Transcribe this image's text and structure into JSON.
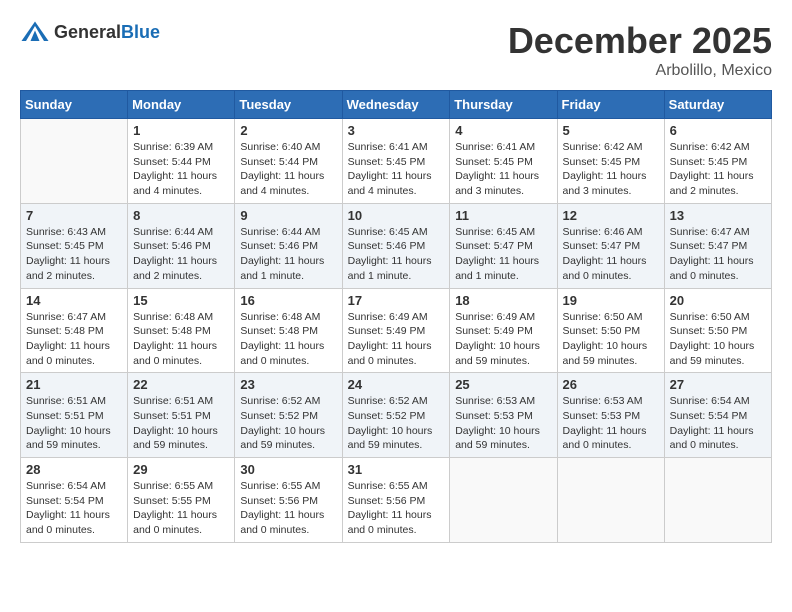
{
  "header": {
    "logo_general": "General",
    "logo_blue": "Blue",
    "month": "December 2025",
    "location": "Arbolillo, Mexico"
  },
  "weekdays": [
    "Sunday",
    "Monday",
    "Tuesday",
    "Wednesday",
    "Thursday",
    "Friday",
    "Saturday"
  ],
  "weeks": [
    [
      {
        "day": "",
        "info": ""
      },
      {
        "day": "1",
        "info": "Sunrise: 6:39 AM\nSunset: 5:44 PM\nDaylight: 11 hours\nand 4 minutes."
      },
      {
        "day": "2",
        "info": "Sunrise: 6:40 AM\nSunset: 5:44 PM\nDaylight: 11 hours\nand 4 minutes."
      },
      {
        "day": "3",
        "info": "Sunrise: 6:41 AM\nSunset: 5:45 PM\nDaylight: 11 hours\nand 4 minutes."
      },
      {
        "day": "4",
        "info": "Sunrise: 6:41 AM\nSunset: 5:45 PM\nDaylight: 11 hours\nand 3 minutes."
      },
      {
        "day": "5",
        "info": "Sunrise: 6:42 AM\nSunset: 5:45 PM\nDaylight: 11 hours\nand 3 minutes."
      },
      {
        "day": "6",
        "info": "Sunrise: 6:42 AM\nSunset: 5:45 PM\nDaylight: 11 hours\nand 2 minutes."
      }
    ],
    [
      {
        "day": "7",
        "info": "Sunrise: 6:43 AM\nSunset: 5:45 PM\nDaylight: 11 hours\nand 2 minutes."
      },
      {
        "day": "8",
        "info": "Sunrise: 6:44 AM\nSunset: 5:46 PM\nDaylight: 11 hours\nand 2 minutes."
      },
      {
        "day": "9",
        "info": "Sunrise: 6:44 AM\nSunset: 5:46 PM\nDaylight: 11 hours\nand 1 minute."
      },
      {
        "day": "10",
        "info": "Sunrise: 6:45 AM\nSunset: 5:46 PM\nDaylight: 11 hours\nand 1 minute."
      },
      {
        "day": "11",
        "info": "Sunrise: 6:45 AM\nSunset: 5:47 PM\nDaylight: 11 hours\nand 1 minute."
      },
      {
        "day": "12",
        "info": "Sunrise: 6:46 AM\nSunset: 5:47 PM\nDaylight: 11 hours\nand 0 minutes."
      },
      {
        "day": "13",
        "info": "Sunrise: 6:47 AM\nSunset: 5:47 PM\nDaylight: 11 hours\nand 0 minutes."
      }
    ],
    [
      {
        "day": "14",
        "info": "Sunrise: 6:47 AM\nSunset: 5:48 PM\nDaylight: 11 hours\nand 0 minutes."
      },
      {
        "day": "15",
        "info": "Sunrise: 6:48 AM\nSunset: 5:48 PM\nDaylight: 11 hours\nand 0 minutes."
      },
      {
        "day": "16",
        "info": "Sunrise: 6:48 AM\nSunset: 5:48 PM\nDaylight: 11 hours\nand 0 minutes."
      },
      {
        "day": "17",
        "info": "Sunrise: 6:49 AM\nSunset: 5:49 PM\nDaylight: 11 hours\nand 0 minutes."
      },
      {
        "day": "18",
        "info": "Sunrise: 6:49 AM\nSunset: 5:49 PM\nDaylight: 10 hours\nand 59 minutes."
      },
      {
        "day": "19",
        "info": "Sunrise: 6:50 AM\nSunset: 5:50 PM\nDaylight: 10 hours\nand 59 minutes."
      },
      {
        "day": "20",
        "info": "Sunrise: 6:50 AM\nSunset: 5:50 PM\nDaylight: 10 hours\nand 59 minutes."
      }
    ],
    [
      {
        "day": "21",
        "info": "Sunrise: 6:51 AM\nSunset: 5:51 PM\nDaylight: 10 hours\nand 59 minutes."
      },
      {
        "day": "22",
        "info": "Sunrise: 6:51 AM\nSunset: 5:51 PM\nDaylight: 10 hours\nand 59 minutes."
      },
      {
        "day": "23",
        "info": "Sunrise: 6:52 AM\nSunset: 5:52 PM\nDaylight: 10 hours\nand 59 minutes."
      },
      {
        "day": "24",
        "info": "Sunrise: 6:52 AM\nSunset: 5:52 PM\nDaylight: 10 hours\nand 59 minutes."
      },
      {
        "day": "25",
        "info": "Sunrise: 6:53 AM\nSunset: 5:53 PM\nDaylight: 10 hours\nand 59 minutes."
      },
      {
        "day": "26",
        "info": "Sunrise: 6:53 AM\nSunset: 5:53 PM\nDaylight: 11 hours\nand 0 minutes."
      },
      {
        "day": "27",
        "info": "Sunrise: 6:54 AM\nSunset: 5:54 PM\nDaylight: 11 hours\nand 0 minutes."
      }
    ],
    [
      {
        "day": "28",
        "info": "Sunrise: 6:54 AM\nSunset: 5:54 PM\nDaylight: 11 hours\nand 0 minutes."
      },
      {
        "day": "29",
        "info": "Sunrise: 6:55 AM\nSunset: 5:55 PM\nDaylight: 11 hours\nand 0 minutes."
      },
      {
        "day": "30",
        "info": "Sunrise: 6:55 AM\nSunset: 5:56 PM\nDaylight: 11 hours\nand 0 minutes."
      },
      {
        "day": "31",
        "info": "Sunrise: 6:55 AM\nSunset: 5:56 PM\nDaylight: 11 hours\nand 0 minutes."
      },
      {
        "day": "",
        "info": ""
      },
      {
        "day": "",
        "info": ""
      },
      {
        "day": "",
        "info": ""
      }
    ]
  ]
}
